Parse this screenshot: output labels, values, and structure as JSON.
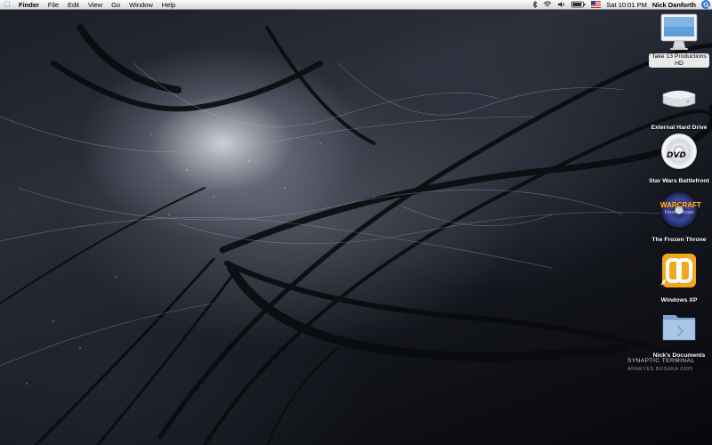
{
  "menubar": {
    "app_name": "Finder",
    "menus": [
      "File",
      "Edit",
      "View",
      "Go",
      "Window",
      "Help"
    ],
    "clock": "Sat 10:01 PM",
    "user": "Nick Danforth",
    "status_icons": [
      "bluetooth-icon",
      "wifi-icon",
      "speaker-icon",
      "battery-icon",
      "us-flag-icon",
      "spotlight-icon"
    ]
  },
  "wallpaper": {
    "title": "SYNAPTIC TERMINAL",
    "credit": "ANHEYES  BOSAKA  2005"
  },
  "desktop_icons": [
    {
      "label_line1": "Take 13 Productions",
      "label_line2": "HD",
      "icon": "imac-icon",
      "selected": true
    },
    {
      "label_line1": "External Hard Drive",
      "icon": "external-drive-icon"
    },
    {
      "label_line1": "Star Wars Battlefront",
      "icon": "dvd-disc-icon",
      "disc_text": "DVD"
    },
    {
      "label_line1": "The Frozen Throne",
      "icon": "warcraft-disc-icon",
      "disc_text": "WARCRAFT",
      "disc_subtext": "Frozen Throne"
    },
    {
      "label_line1": "Windows XP",
      "icon": "parallels-icon"
    },
    {
      "label_line1": "Nick's Documents",
      "icon": "folder-icon"
    }
  ],
  "colors": {
    "menubar_bg": "#e8e8e8",
    "spotlight_blue": "#2f74d0",
    "selection_bg": "#e9e9e9",
    "parallels_orange": "#f2a81d"
  }
}
